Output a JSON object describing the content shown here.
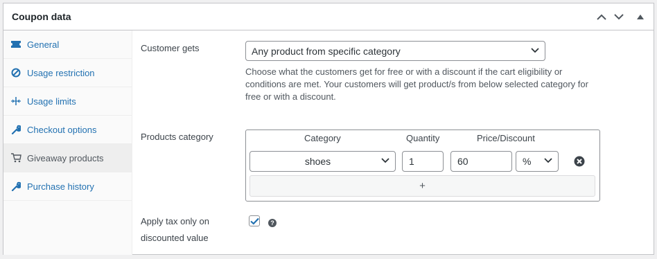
{
  "panel": {
    "title": "Coupon data"
  },
  "sidebar": {
    "items": [
      {
        "label": "General",
        "icon": "ticket-icon"
      },
      {
        "label": "Usage restriction",
        "icon": "block-icon"
      },
      {
        "label": "Usage limits",
        "icon": "limits-icon"
      },
      {
        "label": "Checkout options",
        "icon": "wrench-icon"
      },
      {
        "label": "Giveaway products",
        "icon": "cart-icon",
        "active": true
      },
      {
        "label": "Purchase history",
        "icon": "wrench-icon"
      }
    ]
  },
  "customer_gets": {
    "label": "Customer gets",
    "selected": "Any product from specific category",
    "description_lines": [
      "Choose what the customers get for free or with a discount if the cart eligibility or",
      "conditions are met. Your customers will get product/s from below selected category for",
      "free or with a discount."
    ]
  },
  "products_category": {
    "label": "Products category",
    "headers": {
      "category": "Category",
      "quantity": "Quantity",
      "price": "Price/Discount"
    },
    "row": {
      "category": "shoes",
      "quantity": "1",
      "price": "60",
      "discount_type": "%"
    },
    "add_label": "+"
  },
  "apply_tax": {
    "label_line1": "Apply tax only on",
    "label_line2": "discounted value",
    "checked": true,
    "help": "?"
  },
  "colors": {
    "link": "#2271b1",
    "accent": "#2271b1"
  }
}
